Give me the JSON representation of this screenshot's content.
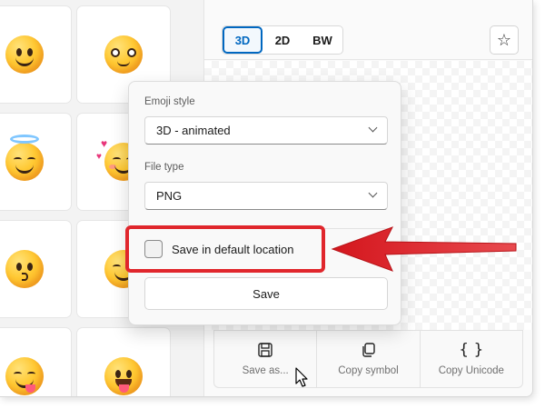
{
  "toolbar": {
    "styles": [
      "3D",
      "2D",
      "BW"
    ],
    "active_style": "3D",
    "favorite_icon": "star-outline-icon"
  },
  "grid": {
    "emojis": [
      "smiling-face-icon",
      "face-with-glasses-icon",
      "smiling-face-with-halo-icon",
      "smiling-face-with-hearts-icon",
      "kissing-face-icon",
      "winking-face-icon",
      "face-savoring-food-icon",
      "grinning-face-with-tongue-icon"
    ]
  },
  "flyout": {
    "style_label": "Emoji style",
    "style_value": "3D - animated",
    "filetype_label": "File type",
    "filetype_value": "PNG",
    "default_location_label": "Save in default location",
    "default_location_checked": false,
    "save_label": "Save"
  },
  "actions": [
    {
      "label": "Save as...",
      "icon": "save-icon"
    },
    {
      "label": "Copy symbol",
      "icon": "copy-icon"
    },
    {
      "label": "Copy Unicode",
      "icon": "braces-icon"
    }
  ],
  "annotation_color": "#e0262c",
  "accent_color": "#0067c0"
}
